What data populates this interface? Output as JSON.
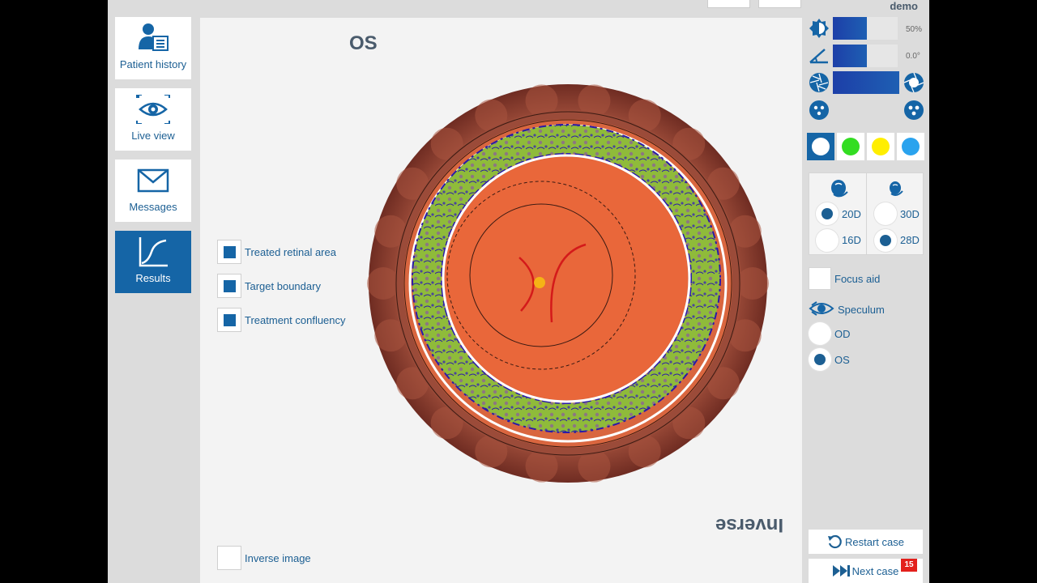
{
  "nav": {
    "patient_history": "Patient history",
    "live_view": "Live view",
    "messages": "Messages",
    "results": "Results"
  },
  "center": {
    "eye_side": "OS",
    "legend": [
      {
        "label": "Treated retinal area",
        "checked": true
      },
      {
        "label": "Target boundary",
        "checked": true
      },
      {
        "label": "Treatment confluency",
        "checked": true
      }
    ],
    "inverse_overlay": "Inverse",
    "inverse_checkbox_label": "Inverse image"
  },
  "right": {
    "user": "demo",
    "brightness_value": "50%",
    "angle_value": "0.0°",
    "colors": [
      {
        "name": "white",
        "hex": "#ffffff",
        "selected": true
      },
      {
        "name": "green",
        "hex": "#33dd22",
        "selected": false
      },
      {
        "name": "yellow",
        "hex": "#ffee00",
        "selected": false
      },
      {
        "name": "blue",
        "hex": "#2aa3ee",
        "selected": false
      }
    ],
    "lens": {
      "left": [
        {
          "label": "20D",
          "checked": true
        },
        {
          "label": "16D",
          "checked": false
        }
      ],
      "right": [
        {
          "label": "30D",
          "checked": false
        },
        {
          "label": "28D",
          "checked": true
        }
      ]
    },
    "focus_aid": "Focus aid",
    "speculum": "Speculum",
    "od": "OD",
    "os": "OS",
    "restart": "Restart case",
    "next": "Next case",
    "next_badge": "15"
  },
  "colors": {
    "accent": "#1565a6",
    "text_blue": "#1c5f93"
  }
}
